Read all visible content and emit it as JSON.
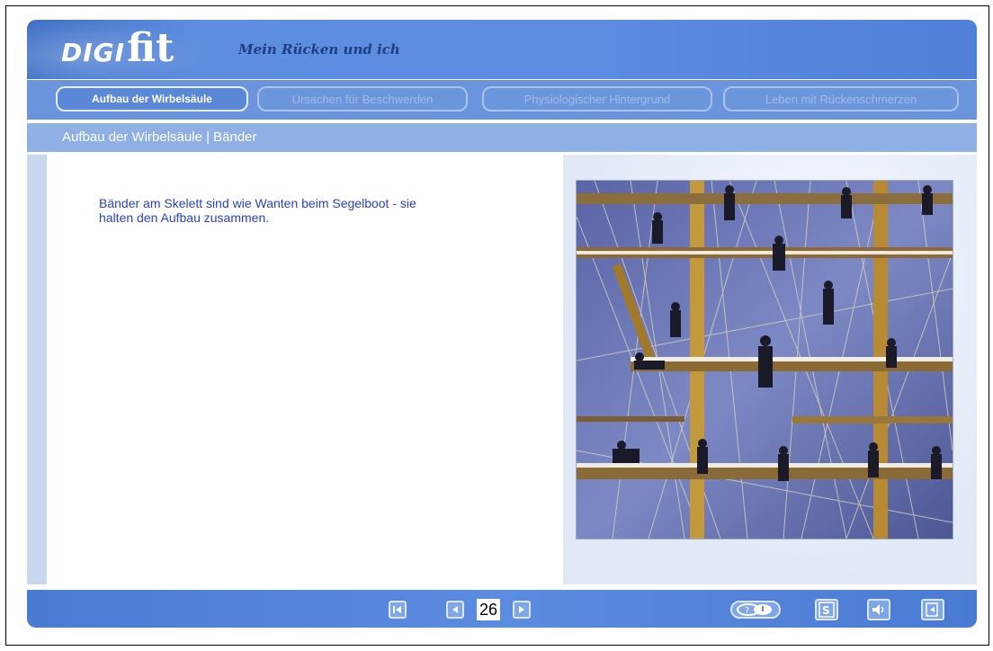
{
  "header": {
    "logo_digi": "DIGI",
    "logo_fit": "fit",
    "subtitle": "Mein Rücken und ich"
  },
  "tabs": [
    {
      "label": "Aufbau der Wirbelsäule",
      "active": true
    },
    {
      "label": "Ursachen für Beschwerden",
      "active": false
    },
    {
      "label": "Physiologischer Hintergrund",
      "active": false
    },
    {
      "label": "Leben mit Rückenschmerzen",
      "active": false
    }
  ],
  "breadcrumb": "Aufbau der Wirbelsäule | Bänder",
  "content": {
    "text": "Bänder am Skelett sind wie Wanten beim Segelboot - sie halten den Aufbau zusammen."
  },
  "footer": {
    "page_number": "26",
    "buttons": [
      "first-page-icon",
      "previous-page-icon",
      "next-page-icon",
      "help-icon",
      "script-icon",
      "sound-icon",
      "exit-icon"
    ]
  },
  "colors": {
    "header_blue": "#5b8ce0",
    "text_blue": "#2a41c6"
  }
}
